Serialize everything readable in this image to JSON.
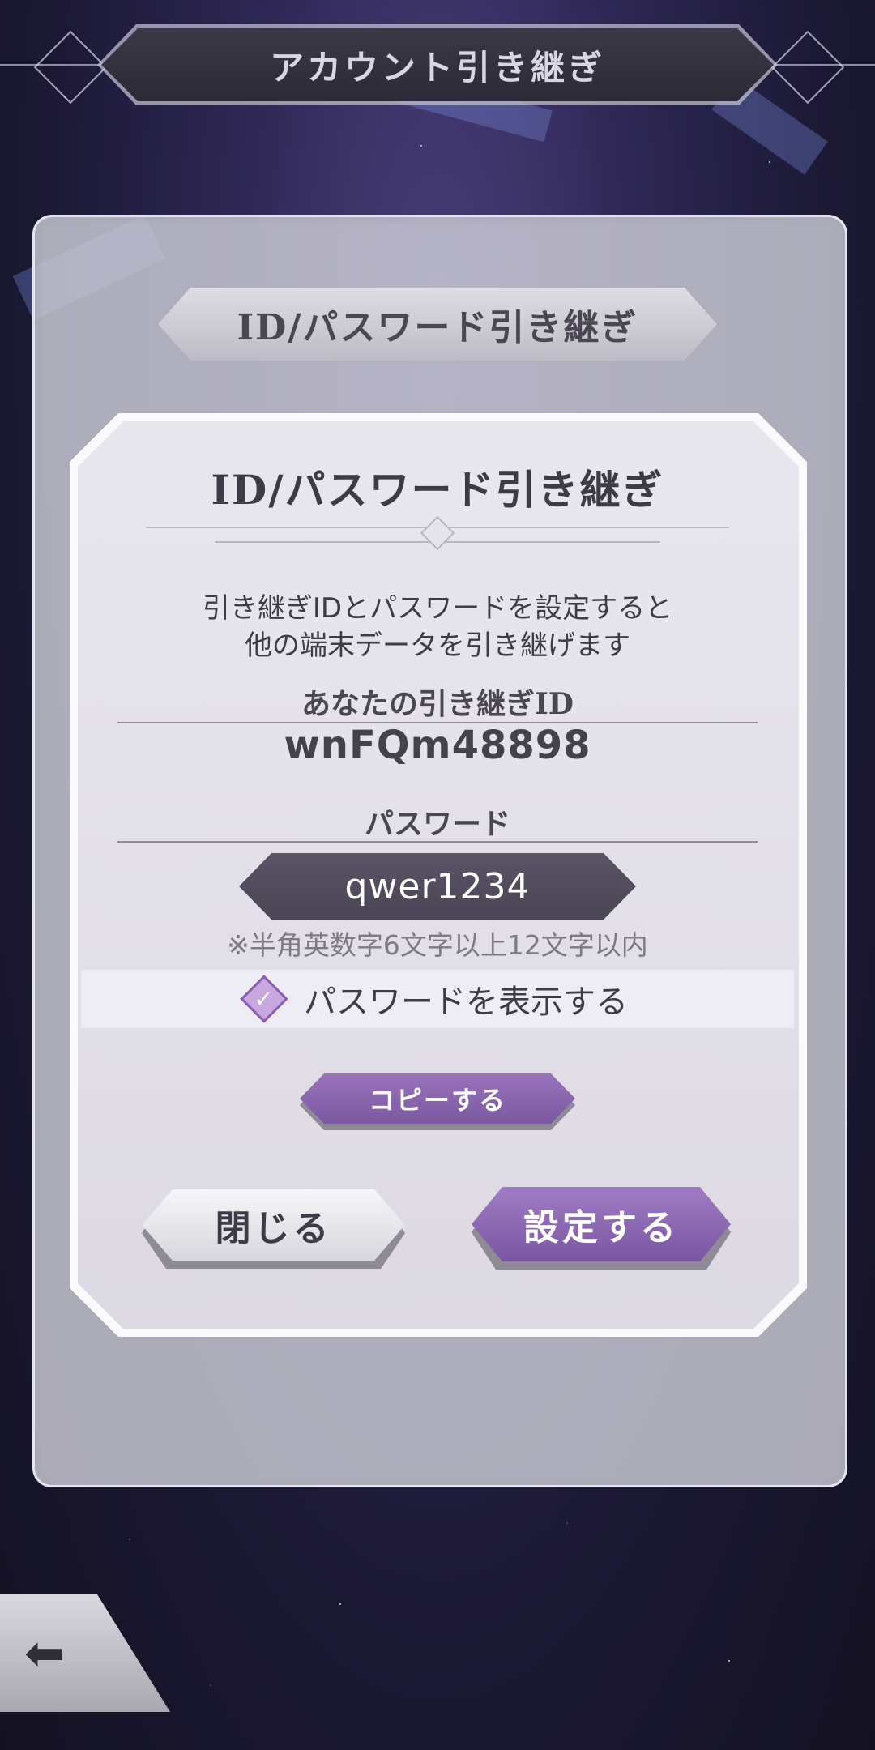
{
  "header": {
    "title": "アカウント引き継ぎ"
  },
  "section": {
    "title": "ID/パスワード引き継ぎ"
  },
  "dialog": {
    "title": "ID/パスワード引き継ぎ",
    "description_line1": "引き継ぎIDとパスワードを設定すると",
    "description_line2": "他の端末データを引き継げます",
    "id_label": "あなたの引き継ぎID",
    "id_value": "wnFQm48898",
    "password_label": "パスワード",
    "password_value": "qwer1234",
    "password_hint": "※半角英数字6文字以上12文字以内",
    "show_password_label": "パスワードを表示する",
    "show_password_checked": true,
    "copy_label": "コピーする",
    "close_label": "閉じる",
    "set_label": "設定する"
  },
  "back_button": {
    "icon": "arrow-left-icon",
    "glyph": "⬅"
  },
  "checkmark_glyph": "✓",
  "colors": {
    "accent_purple": "#8a65b0",
    "field_dark": "#4e4959"
  }
}
